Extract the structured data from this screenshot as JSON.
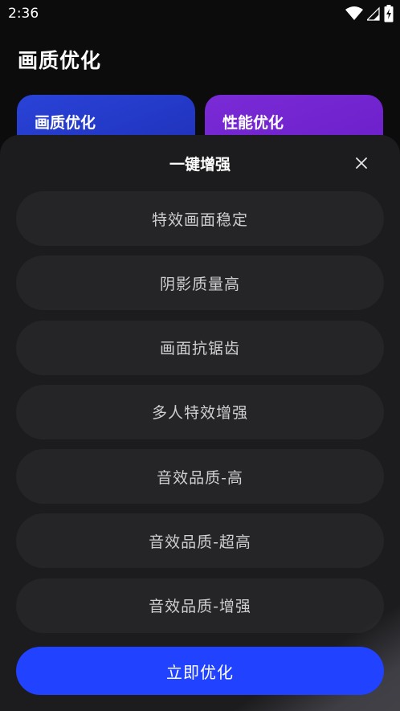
{
  "status_bar": {
    "time": "2:36"
  },
  "page": {
    "title": "画质优化"
  },
  "cards": [
    {
      "label": "画质优化",
      "color": "#1f35c2"
    },
    {
      "label": "性能优化",
      "color": "#7226d0"
    }
  ],
  "sheet": {
    "title": "一键增强",
    "options": [
      "特效画面稳定",
      "阴影质量高",
      "画面抗锯齿",
      "多人特效增强",
      "音效品质-高",
      "音效品质-超高",
      "音效品质-增强"
    ],
    "primary_button": "立即优化"
  },
  "colors": {
    "background": "#0c0c0d",
    "sheet": "#1c1c1e",
    "option": "#252527",
    "accent": "#2142ff"
  },
  "icons": [
    "wifi-icon",
    "cellular-signal-icon",
    "battery-charging-icon",
    "close-icon"
  ]
}
